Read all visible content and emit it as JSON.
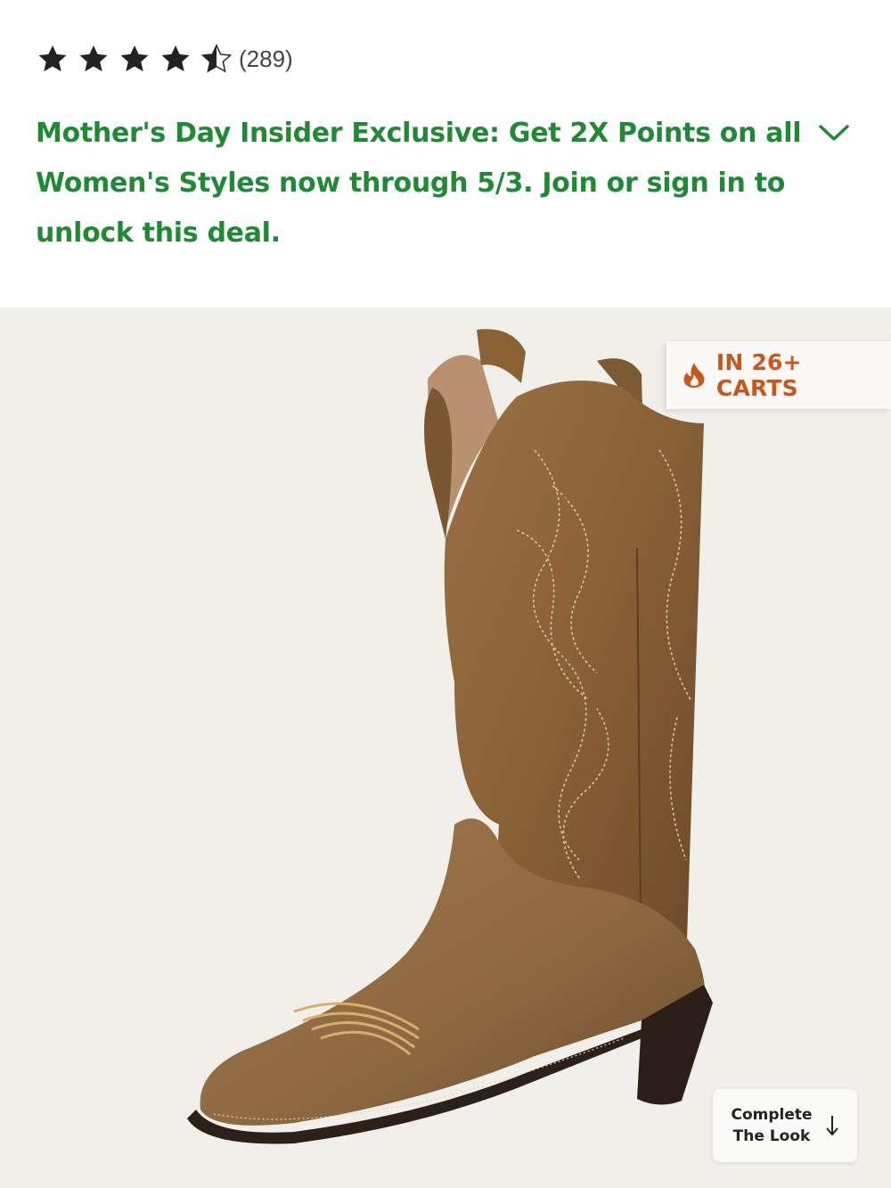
{
  "rating": {
    "value": 4.5,
    "max": 5,
    "count_label": "(289)"
  },
  "promo": {
    "text": "Mother's Day Insider Exclusive: Get 2X Points on all Women's Styles now through 5/3. Join or sign in to unlock this deal.",
    "toggle_icon": "chevron-down-icon",
    "color": "#1f8a34"
  },
  "hero": {
    "badge_label": "IN 26+ CARTS",
    "badge_icon": "fire-icon",
    "badge_color": "#c9561a",
    "complete_look_label": "Complete The Look",
    "complete_look_icon": "arrow-down-icon"
  }
}
